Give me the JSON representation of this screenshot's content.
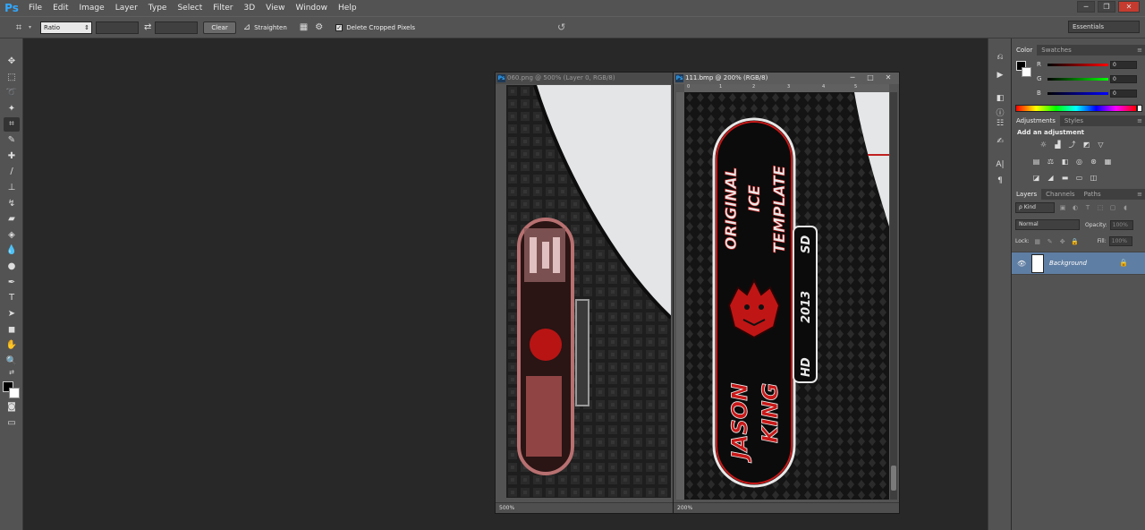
{
  "menubar": {
    "logo": "Ps",
    "items": [
      "File",
      "Edit",
      "Image",
      "Layer",
      "Type",
      "Select",
      "Filter",
      "3D",
      "View",
      "Window",
      "Help"
    ],
    "window_controls": [
      "─",
      "❐",
      "✕"
    ]
  },
  "options": {
    "ratio": "Ratio",
    "clear": "Clear",
    "straighten": "Straighten",
    "delete_cropped": "Delete Cropped Pixels",
    "workspace": "Essentials"
  },
  "doc1": {
    "title": "060.png @ 500% (Layer 0, RGB/8)",
    "zoom": "500%"
  },
  "doc2": {
    "title": "111.bmp @ 200% (RGB/8)",
    "zoom": "200%",
    "ruler_ticks": [
      "0",
      "1",
      "2",
      "3",
      "4",
      "5"
    ],
    "artwork": {
      "line1": "ORIGINAL",
      "line2": "ICE",
      "line3": "TEMPLATE",
      "badge_top": "SD",
      "year": "2013",
      "badge_bottom": "HD",
      "name1": "JASON",
      "name2": "KING"
    }
  },
  "doc_controls": [
    "─",
    "□",
    "✕"
  ],
  "color_panel": {
    "tabs": [
      "Color",
      "Swatches"
    ],
    "r_label": "R",
    "g_label": "G",
    "b_label": "B",
    "r": "0",
    "g": "0",
    "b": "0"
  },
  "adjustments": {
    "tabs": [
      "Adjustments",
      "Styles"
    ],
    "title": "Add an adjustment"
  },
  "layers": {
    "tabs": [
      "Layers",
      "Channels",
      "Paths"
    ],
    "kind": "ρ Kind",
    "blend": "Normal",
    "opacity_label": "Opacity:",
    "opacity": "100%",
    "lock_label": "Lock:",
    "fill_label": "Fill:",
    "fill": "100%",
    "layer_name": "Background"
  },
  "colors": {
    "ps_blue": "#31a8ff",
    "artwork_red": "#d81e1e",
    "layer_selected": "#5f7ea3"
  }
}
